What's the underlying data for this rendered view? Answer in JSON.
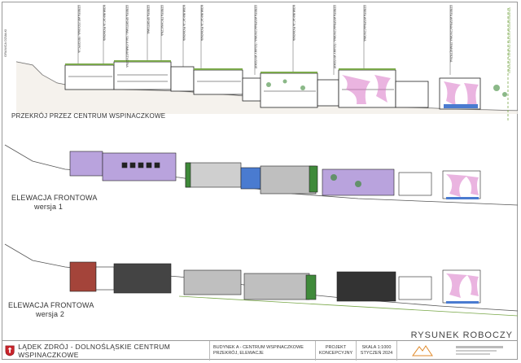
{
  "section": {
    "title": "PRZEKRÓJ PRZEZ CENTRUM WSPINACZKOWE",
    "boundary_left": "GRANICA DZIAŁKI",
    "boundary_right": "GRANICA TERENU ZAGOSPODAROWANIA",
    "zone_labels": [
      "STREFA WEJŚCIOWA / RECEPCJA",
      "KOMUNIKACJA PIONOWA",
      "STREFA SPORTOWA / SALA GIMNASTYCZNA",
      "STREFA SPORTOWA",
      "STREFA TECHNICZNA",
      "KOMUNIKACJA PIONOWA",
      "KOMUNIKACJA PIONOWA",
      "STREFA WSPINACZKOWA / ŚCIANY WYSOKIE",
      "KOMUNIKACJA PIONOWA",
      "STREFA WSPINACZKOWA / ŚCIANY WYSOKIE",
      "STREFA WSPINACZKOWA",
      "STREFA WSPINACZKOWA ZEWNĘTRZNA"
    ]
  },
  "elevation1": {
    "title": "ELEWACJA FRONTOWA",
    "subtitle": "wersja 1"
  },
  "elevation2": {
    "title": "ELEWACJA FRONTOWA",
    "subtitle": "wersja 2"
  },
  "watermark": "RYSUNEK ROBOCZY",
  "title_block": {
    "project_name": "LĄDEK ZDRÓJ - DOLNOŚLĄSKIE CENTRUM WSPINACZKOWE",
    "building_line1": "BUDYNEK A - CENTRUM WSPINACZKOWE",
    "building_line2": "PRZEKRÓJ, ELEWACJE",
    "phase_line1": "PROJEKT",
    "phase_line2": "KONCEPCYJNY",
    "scale": "SKALA 1:1000",
    "date": "STYCZEŃ 2024"
  },
  "colors": {
    "facade_purple": "#b9a3dd",
    "facade_green": "#3f8a3a",
    "facade_blue": "#4a7bd0",
    "facade_brick": "#a4443a",
    "climbing_pink": "#d978c8",
    "glazing_grey": "#8a8a8a",
    "ground_green": "#7aa84a",
    "line_dark": "#222222"
  }
}
